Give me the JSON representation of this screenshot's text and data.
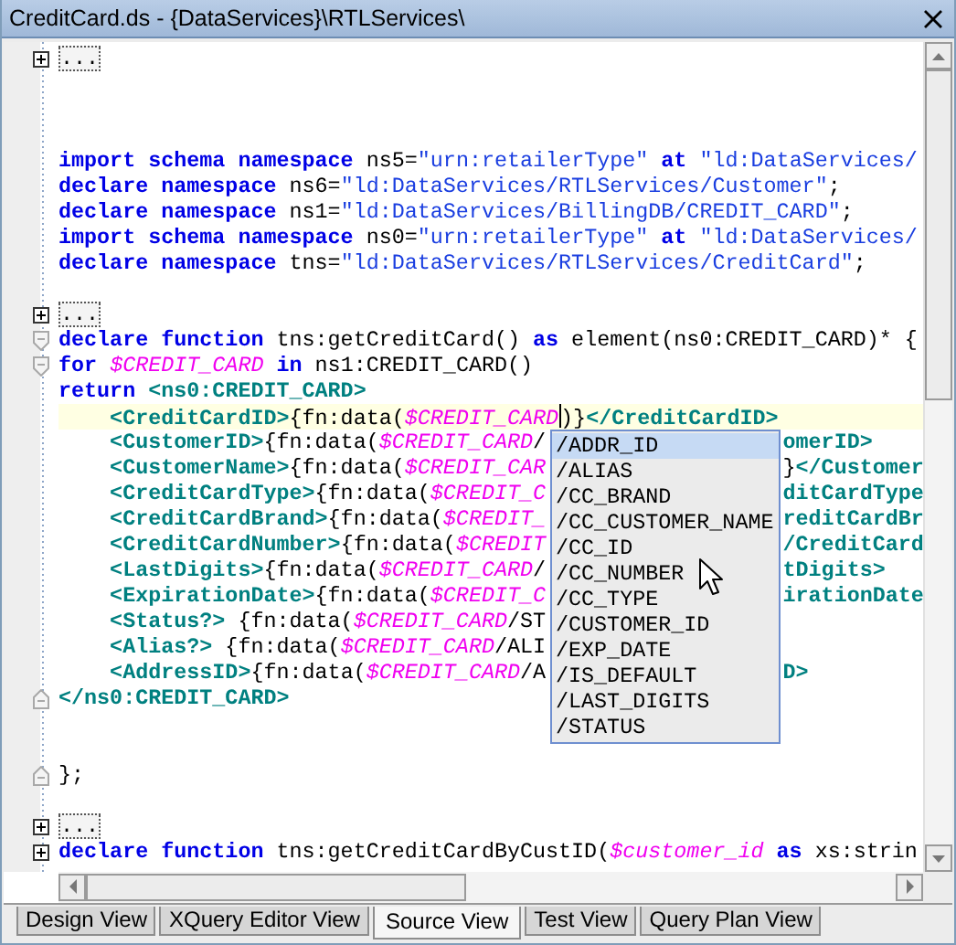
{
  "window": {
    "title": "CreditCard.ds - {DataServices}\\RTLServices\\"
  },
  "lines": [
    {
      "kind": "collapsed",
      "current": false,
      "parts": [
        {
          "kind": "collapsed",
          "text": "..."
        }
      ]
    },
    {
      "kind": "code",
      "current": false
    },
    {
      "kind": "code",
      "current": false
    },
    {
      "kind": "code",
      "current": false
    },
    {
      "kind": "code",
      "current": false,
      "parts": [
        {
          "kind": "kw",
          "text": "import schema namespace"
        },
        {
          "kind": "plain",
          "text": " ns5="
        },
        {
          "kind": "str",
          "text": "\"urn:retailerType\""
        },
        {
          "kind": "kw",
          "text": " at "
        },
        {
          "kind": "str",
          "text": "\"ld:DataServices/"
        }
      ]
    },
    {
      "kind": "code",
      "current": false,
      "parts": [
        {
          "kind": "kw",
          "text": "declare namespace"
        },
        {
          "kind": "plain",
          "text": " ns6="
        },
        {
          "kind": "str",
          "text": "\"ld:DataServices/RTLServices/Customer\""
        },
        {
          "kind": "plain",
          "text": ";"
        }
      ]
    },
    {
      "kind": "code",
      "current": false,
      "parts": [
        {
          "kind": "kw",
          "text": "declare namespace"
        },
        {
          "kind": "plain",
          "text": " ns1="
        },
        {
          "kind": "str",
          "text": "\"ld:DataServices/BillingDB/CREDIT_CARD\""
        },
        {
          "kind": "plain",
          "text": ";"
        }
      ]
    },
    {
      "kind": "code",
      "current": false,
      "parts": [
        {
          "kind": "kw",
          "text": "import schema namespace"
        },
        {
          "kind": "plain",
          "text": " ns0="
        },
        {
          "kind": "str",
          "text": "\"urn:retailerType\""
        },
        {
          "kind": "kw",
          "text": " at "
        },
        {
          "kind": "str",
          "text": "\"ld:DataServices/"
        }
      ]
    },
    {
      "kind": "code",
      "current": false,
      "parts": [
        {
          "kind": "kw",
          "text": "declare namespace"
        },
        {
          "kind": "plain",
          "text": " tns="
        },
        {
          "kind": "str",
          "text": "\"ld:DataServices/RTLServices/CreditCard\""
        },
        {
          "kind": "plain",
          "text": ";"
        }
      ]
    },
    {
      "kind": "code",
      "current": false
    },
    {
      "kind": "collapsed",
      "current": false,
      "parts": [
        {
          "kind": "collapsed",
          "text": "..."
        }
      ]
    },
    {
      "kind": "fold-start",
      "current": false,
      "parts": [
        {
          "kind": "kw",
          "text": "declare function"
        },
        {
          "kind": "plain",
          "text": " tns:getCreditCard() "
        },
        {
          "kind": "kw",
          "text": "as"
        },
        {
          "kind": "plain",
          "text": " element(ns0:CREDIT_CARD)* {"
        }
      ]
    },
    {
      "kind": "fold-start",
      "current": false,
      "parts": [
        {
          "kind": "kw",
          "text": "for "
        },
        {
          "kind": "var",
          "text": "$CREDIT_CARD"
        },
        {
          "kind": "kw",
          "text": " in"
        },
        {
          "kind": "plain",
          "text": " ns1:CREDIT_CARD()"
        }
      ]
    },
    {
      "kind": "code",
      "current": false,
      "parts": [
        {
          "kind": "kw",
          "text": "return"
        },
        {
          "kind": "tag",
          "text": " <ns0:CREDIT_CARD>"
        }
      ]
    },
    {
      "kind": "code",
      "current": true,
      "parts": [
        {
          "kind": "tag",
          "text": "    <CreditCardID>"
        },
        {
          "kind": "plain",
          "text": "{fn:data("
        },
        {
          "kind": "var",
          "text": "$CREDIT_CARD"
        },
        {
          "kind": "caret"
        },
        {
          "kind": "plain",
          "text": ")}"
        },
        {
          "kind": "tag",
          "text": "</CreditCardID>"
        }
      ]
    },
    {
      "kind": "code",
      "current": false,
      "parts": [
        {
          "kind": "tag",
          "text": "    <CustomerID>"
        },
        {
          "kind": "plain",
          "text": "{fn:data("
        },
        {
          "kind": "var",
          "text": "$CREDIT_CARD"
        },
        {
          "kind": "plain",
          "text": "/"
        }
      ],
      "after": [
        {
          "kind": "tag",
          "text": "omerID>"
        }
      ]
    },
    {
      "kind": "code",
      "current": false,
      "parts": [
        {
          "kind": "tag",
          "text": "    <CustomerName>"
        },
        {
          "kind": "plain",
          "text": "{fn:data("
        },
        {
          "kind": "var",
          "text": "$CREDIT_CAR"
        }
      ],
      "after": [
        {
          "kind": "plain",
          "text": "}"
        },
        {
          "kind": "tag",
          "text": "</Customer"
        }
      ]
    },
    {
      "kind": "code",
      "current": false,
      "parts": [
        {
          "kind": "tag",
          "text": "    <CreditCardType>"
        },
        {
          "kind": "plain",
          "text": "{fn:data("
        },
        {
          "kind": "var",
          "text": "$CREDIT_C"
        }
      ],
      "after": [
        {
          "kind": "tag",
          "text": "ditCardType"
        }
      ]
    },
    {
      "kind": "code",
      "current": false,
      "parts": [
        {
          "kind": "tag",
          "text": "    <CreditCardBrand>"
        },
        {
          "kind": "plain",
          "text": "{fn:data("
        },
        {
          "kind": "var",
          "text": "$CREDIT_"
        }
      ],
      "after": [
        {
          "kind": "tag",
          "text": "reditCardBr"
        }
      ]
    },
    {
      "kind": "code",
      "current": false,
      "parts": [
        {
          "kind": "tag",
          "text": "    <CreditCardNumber>"
        },
        {
          "kind": "plain",
          "text": "{fn:data("
        },
        {
          "kind": "var",
          "text": "$CREDIT"
        }
      ],
      "after": [
        {
          "kind": "tag",
          "text": "/CreditCard"
        }
      ]
    },
    {
      "kind": "code",
      "current": false,
      "parts": [
        {
          "kind": "tag",
          "text": "    <LastDigits>"
        },
        {
          "kind": "plain",
          "text": "{fn:data("
        },
        {
          "kind": "var",
          "text": "$CREDIT_CARD"
        },
        {
          "kind": "plain",
          "text": "/"
        }
      ],
      "after": [
        {
          "kind": "tag",
          "text": "tDigits>"
        }
      ]
    },
    {
      "kind": "code",
      "current": false,
      "parts": [
        {
          "kind": "tag",
          "text": "    <ExpirationDate>"
        },
        {
          "kind": "plain",
          "text": "{fn:data("
        },
        {
          "kind": "var",
          "text": "$CREDIT_C"
        }
      ],
      "after": [
        {
          "kind": "tag",
          "text": "irationDate"
        }
      ]
    },
    {
      "kind": "code",
      "current": false,
      "parts": [
        {
          "kind": "tag",
          "text": "    <Status?>"
        },
        {
          "kind": "plain",
          "text": " {fn:data("
        },
        {
          "kind": "var",
          "text": "$CREDIT_CARD"
        },
        {
          "kind": "plain",
          "text": "/ST"
        }
      ]
    },
    {
      "kind": "code",
      "current": false,
      "parts": [
        {
          "kind": "tag",
          "text": "    <Alias?>"
        },
        {
          "kind": "plain",
          "text": " {fn:data("
        },
        {
          "kind": "var",
          "text": "$CREDIT_CARD"
        },
        {
          "kind": "plain",
          "text": "/ALI"
        }
      ]
    },
    {
      "kind": "code",
      "current": false,
      "parts": [
        {
          "kind": "tag",
          "text": "    <AddressID>"
        },
        {
          "kind": "plain",
          "text": "{fn:data("
        },
        {
          "kind": "var",
          "text": "$CREDIT_CARD"
        },
        {
          "kind": "plain",
          "text": "/A"
        }
      ],
      "after": [
        {
          "kind": "tag",
          "text": "D>"
        }
      ]
    },
    {
      "kind": "fold-end",
      "current": false,
      "parts": [
        {
          "kind": "tag",
          "text": "</ns0:CREDIT_CARD>"
        }
      ]
    },
    {
      "kind": "code",
      "current": false
    },
    {
      "kind": "code",
      "current": false
    },
    {
      "kind": "fold-end",
      "current": false,
      "parts": [
        {
          "kind": "plain",
          "text": "};"
        }
      ]
    },
    {
      "kind": "code",
      "current": false
    },
    {
      "kind": "collapsed",
      "current": false,
      "parts": [
        {
          "kind": "collapsed",
          "text": "..."
        }
      ]
    },
    {
      "kind": "collapsed",
      "current": false,
      "parts": [
        {
          "kind": "kw",
          "text": "declare function"
        },
        {
          "kind": "plain",
          "text": " tns:getCreditCardByCustID("
        },
        {
          "kind": "var",
          "text": "$customer_id"
        },
        {
          "kind": "kw",
          "text": " as"
        },
        {
          "kind": "plain",
          "text": " xs:strin"
        }
      ]
    }
  ],
  "completion": {
    "items": [
      {
        "label": "/ADDR_ID",
        "selected": true
      },
      {
        "label": "/ALIAS",
        "selected": false
      },
      {
        "label": "/CC_BRAND",
        "selected": false
      },
      {
        "label": "/CC_CUSTOMER_NAME",
        "selected": false
      },
      {
        "label": "/CC_ID",
        "selected": false
      },
      {
        "label": "/CC_NUMBER",
        "selected": false
      },
      {
        "label": "/CC_TYPE",
        "selected": false
      },
      {
        "label": "/CUSTOMER_ID",
        "selected": false
      },
      {
        "label": "/EXP_DATE",
        "selected": false
      },
      {
        "label": "/IS_DEFAULT",
        "selected": false
      },
      {
        "label": "/LAST_DIGITS",
        "selected": false
      },
      {
        "label": "/STATUS",
        "selected": false
      }
    ]
  },
  "tabs": [
    {
      "label": "Design View",
      "selected": false
    },
    {
      "label": "XQuery Editor View",
      "selected": false
    },
    {
      "label": "Source View",
      "selected": true
    },
    {
      "label": "Test View",
      "selected": false
    },
    {
      "label": "Query Plan View",
      "selected": false
    }
  ]
}
